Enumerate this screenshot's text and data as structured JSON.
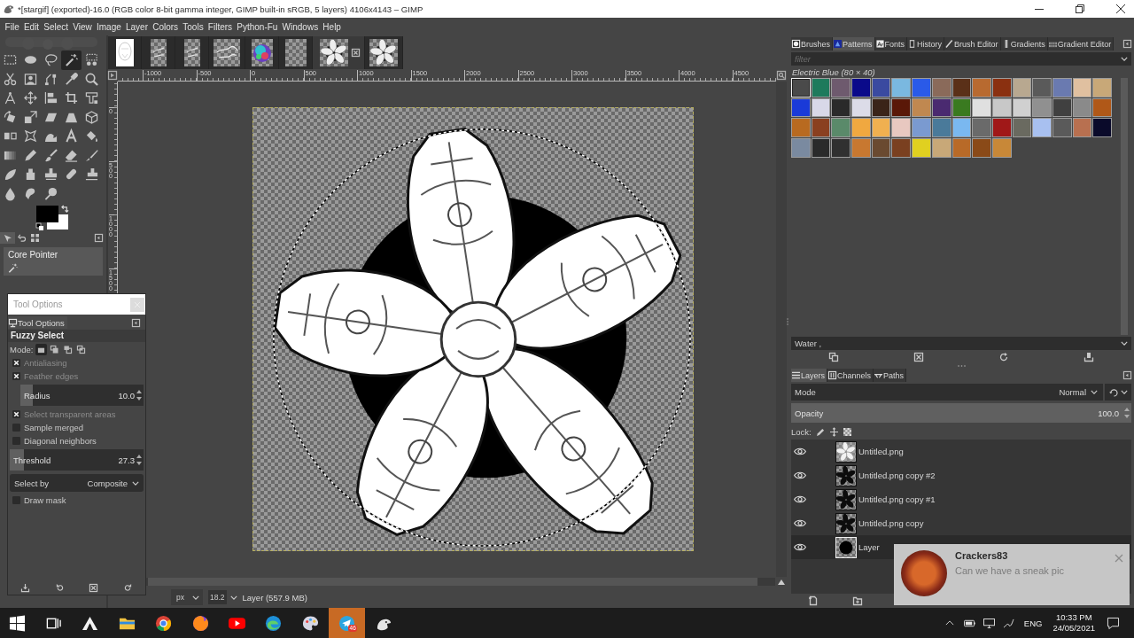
{
  "window": {
    "title": "*[stargif] (exported)-16.0 (RGB color 8-bit gamma integer, GIMP built-in sRGB, 5 layers) 4106x4143 – GIMP"
  },
  "menu": [
    "File",
    "Edit",
    "Select",
    "View",
    "Image",
    "Layer",
    "Colors",
    "Tools",
    "Filters",
    "Python-Fu",
    "Windows",
    "Help"
  ],
  "toolbox": {
    "tools": [
      {
        "kind": "rect",
        "selected": false
      },
      {
        "kind": "ellipse",
        "selected": false
      },
      {
        "kind": "lasso",
        "selected": false
      },
      {
        "kind": "wand",
        "selected": true
      },
      {
        "kind": "bycolor",
        "selected": false
      },
      {
        "kind": "scissors",
        "selected": false
      },
      {
        "kind": "foreground",
        "selected": false
      },
      {
        "kind": "paths",
        "selected": false
      },
      {
        "kind": "picker",
        "selected": false
      },
      {
        "kind": "zoom",
        "selected": false
      },
      {
        "kind": "measure",
        "selected": false
      },
      {
        "kind": "move",
        "selected": false
      },
      {
        "kind": "align",
        "selected": false
      },
      {
        "kind": "crop",
        "selected": false
      },
      {
        "kind": "transform",
        "selected": false
      },
      {
        "kind": "rotate",
        "selected": false
      },
      {
        "kind": "scale",
        "selected": false
      },
      {
        "kind": "shear",
        "selected": false
      },
      {
        "kind": "perspective",
        "selected": false
      },
      {
        "kind": "cube",
        "selected": false
      },
      {
        "kind": "flip",
        "selected": false
      },
      {
        "kind": "cage",
        "selected": false
      },
      {
        "kind": "warp",
        "selected": false
      },
      {
        "kind": "text",
        "selected": false
      },
      {
        "kind": "bucket",
        "selected": false
      },
      {
        "kind": "gradient",
        "selected": false
      },
      {
        "kind": "pencil",
        "selected": false
      },
      {
        "kind": "brush",
        "selected": false
      },
      {
        "kind": "eraser",
        "selected": false
      },
      {
        "kind": "airbrush",
        "selected": false
      },
      {
        "kind": "ink",
        "selected": false
      },
      {
        "kind": "mypaint",
        "selected": false
      },
      {
        "kind": "clone",
        "selected": false
      },
      {
        "kind": "heal",
        "selected": false
      },
      {
        "kind": "pclone",
        "selected": false
      },
      {
        "kind": "blur",
        "selected": false
      },
      {
        "kind": "smudge",
        "selected": false
      },
      {
        "kind": "dodge",
        "selected": false
      }
    ],
    "colors": [
      {
        "kind": "foreground",
        "color": "#000000"
      },
      {
        "kind": "background",
        "color": "#ffffff"
      }
    ],
    "dock_tabs": [
      {
        "kind": "device",
        "selected": true
      },
      {
        "kind": "undo",
        "selected": false
      },
      {
        "kind": "images",
        "selected": false
      }
    ],
    "device": {
      "label": "Core Pointer"
    }
  },
  "image_tabs": [
    {
      "kind": "sketch",
      "selected": false
    },
    {
      "kind": "faint",
      "selected": false
    },
    {
      "kind": "faint",
      "selected": false
    },
    {
      "kind": "scribble",
      "selected": false
    },
    {
      "kind": "colorful",
      "selected": false
    },
    {
      "kind": "empty",
      "selected": false
    },
    {
      "kind": "star",
      "selected": true
    },
    {
      "kind": "star",
      "selected": false
    }
  ],
  "rulers": {
    "horizontal": [
      "-1000",
      "-500",
      "0",
      "500",
      "1000",
      "1500",
      "2000",
      "2500",
      "3000",
      "3500",
      "4000",
      "4500"
    ],
    "vertical": [
      "0",
      "500",
      "1000",
      "1500"
    ]
  },
  "status_bar": {
    "unit": "px",
    "zoom": "18.2",
    "info": "Layer (557.9 MB)"
  },
  "tool_options": {
    "title": "Tool Options",
    "tab": "Tool Options",
    "tool": "Fuzzy Select",
    "mode_label": "Mode:",
    "modes": [
      {
        "kind": "replace",
        "selected": true
      },
      {
        "kind": "add",
        "selected": false
      },
      {
        "kind": "subtract",
        "selected": false
      },
      {
        "kind": "intersect",
        "selected": false
      }
    ],
    "options": [
      {
        "kind": "checkbox",
        "label": "Antialiasing",
        "checked": true
      },
      {
        "kind": "checkbox",
        "label": "Feather edges",
        "checked": true,
        "children": [
          {
            "kind": "slider",
            "label": "Radius",
            "reading": "10.0",
            "level": 0.1
          }
        ]
      },
      {
        "kind": "checkbox",
        "label": "Select transparent areas",
        "checked": true
      },
      {
        "kind": "checkbox",
        "label": "Sample merged",
        "checked": false
      },
      {
        "kind": "checkbox",
        "label": "Diagonal neighbors",
        "checked": false
      },
      {
        "kind": "slider",
        "label": "Threshold",
        "reading": "27.3",
        "level": 0.107
      },
      {
        "kind": "dropdown",
        "label": "Select by",
        "value": "Composite"
      },
      {
        "kind": "checkbox",
        "label": "Draw mask",
        "checked": false
      }
    ]
  },
  "dock": {
    "tabs": [
      {
        "kind": "brushes",
        "label": "Brushes",
        "selected": false
      },
      {
        "kind": "patterns",
        "label": "Patterns",
        "selected": true
      },
      {
        "kind": "fonts",
        "label": "Fonts",
        "selected": false
      },
      {
        "kind": "history",
        "label": "History",
        "selected": false
      },
      {
        "kind": "brusheditor",
        "label": "Brush Editor",
        "selected": false
      },
      {
        "kind": "gradients",
        "label": "Gradients",
        "selected": false
      },
      {
        "kind": "gradienteditor",
        "label": "Gradient Editor",
        "selected": false
      }
    ],
    "filter": {
      "placeholder": "filter"
    },
    "pattern_name": "Electric Blue (80 × 40)",
    "patterns": [
      {
        "color": "#4a4a4a",
        "selected": true
      },
      {
        "color": "#1e7a5c",
        "selected": false
      },
      {
        "color": "#6e5a6e",
        "selected": false
      },
      {
        "color": "#0a0a8a",
        "selected": false
      },
      {
        "color": "#3a4aa0",
        "selected": false
      },
      {
        "color": "#7ab8e0",
        "selected": false
      },
      {
        "color": "#2a5ae8",
        "selected": false
      },
      {
        "color": "#8a6a5a",
        "selected": false
      },
      {
        "color": "#5a3018",
        "selected": false
      },
      {
        "color": "#b86a30",
        "selected": false
      },
      {
        "color": "#8a3010",
        "selected": false
      },
      {
        "color": "#b8a890",
        "selected": false
      },
      {
        "color": "#5a5a5a",
        "selected": false
      },
      {
        "color": "#6a7ab0",
        "selected": false
      },
      {
        "color": "#e0c0a0",
        "selected": false
      },
      {
        "color": "#c8a878",
        "selected": false
      },
      {
        "color": "#1a3ad8",
        "selected": false
      },
      {
        "color": "#d8d8e8",
        "selected": false
      },
      {
        "color": "#2a2a2a",
        "selected": false
      },
      {
        "color": "#dcdce8",
        "selected": false
      },
      {
        "color": "#3a2418",
        "selected": false
      },
      {
        "color": "#5a1808",
        "selected": false
      },
      {
        "color": "#c08850",
        "selected": false
      },
      {
        "color": "#4a2a70",
        "selected": false
      },
      {
        "color": "#3a7a20",
        "selected": false
      },
      {
        "color": "#e0e0e0",
        "selected": false
      },
      {
        "color": "#c8c8c8",
        "selected": false
      },
      {
        "color": "#d0d0d0",
        "selected": false
      },
      {
        "color": "#909090",
        "selected": false
      },
      {
        "color": "#404040",
        "selected": false
      },
      {
        "color": "#8a8a8a",
        "selected": false
      },
      {
        "color": "#b05818",
        "selected": false
      },
      {
        "color": "#b86a20",
        "selected": false
      },
      {
        "color": "#8a4020",
        "selected": false
      },
      {
        "color": "#5a8a6a",
        "selected": false
      },
      {
        "color": "#f0a840",
        "selected": false
      },
      {
        "color": "#f0b050",
        "selected": false
      },
      {
        "color": "#e8c8c0",
        "selected": false
      },
      {
        "color": "#7a9ad0",
        "selected": false
      },
      {
        "color": "#4a7a9a",
        "selected": false
      },
      {
        "color": "#7ab8f0",
        "selected": false
      },
      {
        "color": "#6a6a6a",
        "selected": false
      },
      {
        "color": "#a01818",
        "selected": false
      },
      {
        "color": "#6a6a60",
        "selected": false
      },
      {
        "color": "#a8c0f0",
        "selected": false
      },
      {
        "color": "#5a5a5a",
        "selected": false
      },
      {
        "color": "#b87050",
        "selected": false
      },
      {
        "color": "#0a0a2a",
        "selected": false
      },
      {
        "color": "#7a8aa0",
        "selected": false
      },
      {
        "color": "#2a2a2a",
        "selected": false
      },
      {
        "color": "#303030",
        "selected": false
      },
      {
        "color": "#c87830",
        "selected": false
      },
      {
        "color": "#6a4a30",
        "selected": false
      },
      {
        "color": "#7a4020",
        "selected": false
      },
      {
        "color": "#e0d020",
        "selected": false
      },
      {
        "color": "#c8a878",
        "selected": false
      },
      {
        "color": "#b86a28",
        "selected": false
      },
      {
        "color": "#8a4a18",
        "selected": false
      },
      {
        "color": "#c88838",
        "selected": false
      }
    ],
    "tags": {
      "value": "Water ,"
    }
  },
  "layers_panel": {
    "tabs": [
      {
        "kind": "layers",
        "label": "Layers",
        "selected": true
      },
      {
        "kind": "channels",
        "label": "Channels",
        "selected": false
      },
      {
        "kind": "paths",
        "label": "Paths",
        "selected": false
      }
    ],
    "mode_label": "Mode",
    "mode": "Normal",
    "opacity": {
      "label": "Opacity",
      "reading": "100.0",
      "level": 1
    },
    "lock_label": "Lock:",
    "layers": [
      {
        "name": "Untitled.png",
        "kind": "light",
        "visible": true,
        "selected": false
      },
      {
        "name": "Untitled.png copy #2",
        "kind": "dark",
        "visible": true,
        "selected": false
      },
      {
        "name": "Untitled.png copy #1",
        "kind": "dark",
        "visible": true,
        "selected": false
      },
      {
        "name": "Untitled.png copy",
        "kind": "dark",
        "visible": true,
        "selected": false
      },
      {
        "name": "Layer",
        "kind": "disk",
        "visible": true,
        "selected": true
      }
    ]
  },
  "taskbar": {
    "apps": [
      {
        "kind": "start",
        "flashing": false
      },
      {
        "kind": "taskview",
        "flashing": false
      },
      {
        "kind": "peak",
        "flashing": false
      },
      {
        "kind": "explorer",
        "flashing": false
      },
      {
        "kind": "chrome",
        "flashing": false
      },
      {
        "kind": "firefox",
        "flashing": false
      },
      {
        "kind": "youtube",
        "flashing": false
      },
      {
        "kind": "edge",
        "flashing": false
      },
      {
        "kind": "paint",
        "flashing": false
      },
      {
        "kind": "telegram",
        "flashing": true,
        "badge": "46"
      },
      {
        "kind": "gimp",
        "flashing": false
      }
    ],
    "language": "ENG",
    "time": "10:33 PM",
    "date": "24/05/2021"
  },
  "notification": {
    "sender": "Crackers83",
    "message": "Can we have a sneak pic"
  }
}
